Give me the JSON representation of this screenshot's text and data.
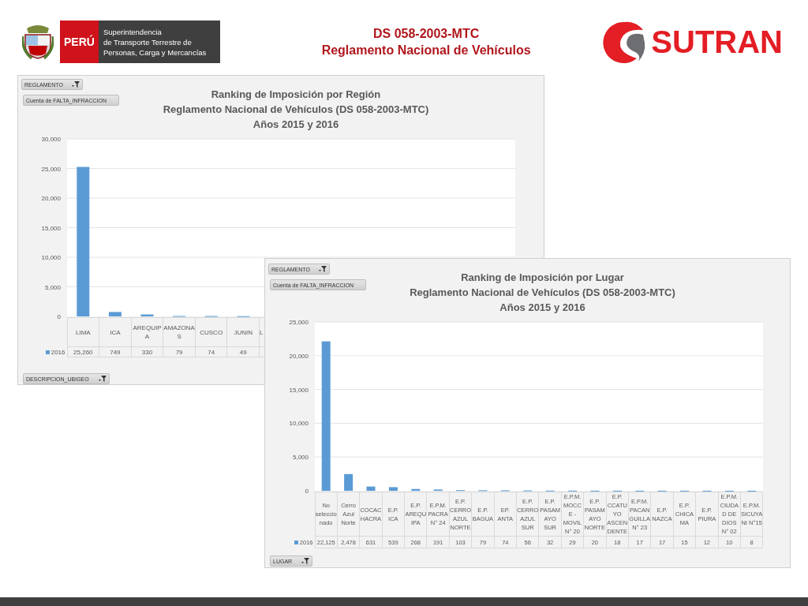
{
  "header": {
    "country": "PERÚ",
    "agency_lines": [
      "Superintendencia",
      "de Transporte Terrestre de",
      "Personas, Carga y Mercancías"
    ],
    "title_lines": [
      "DS 058-2003-MTC",
      "Reglamento Nacional de Vehículos"
    ],
    "brand": "SUTRAN"
  },
  "panels": [
    {
      "filter": "REGLAMENTO",
      "value_field": "Cuenta de FALTA_INFRACCION",
      "title_lines": [
        "Ranking de Imposición por Región",
        "Reglamento Nacional de Vehículos (DS 058-2003-MTC)",
        "Años 2015 y 2016"
      ],
      "axis_field": "DESCRIPCION_UBIGEO",
      "chart_data": {
        "type": "bar",
        "categories": [
          "LIMA",
          "ICA",
          "AREQUIPA",
          "AMAZONAS",
          "CUSCO",
          "JUNIN",
          "L"
        ],
        "series": [
          {
            "name": "2016",
            "color": "#5b9bd5",
            "values": [
              25260,
              749,
              330,
              79,
              74,
              49,
              null
            ]
          }
        ],
        "ylim": [
          0,
          30000
        ],
        "yticks": [
          {
            "value": 0,
            "label": "0"
          },
          {
            "value": 5000,
            "label": "5,000"
          },
          {
            "value": 10000,
            "label": "10,000"
          },
          {
            "value": 15000,
            "label": "15,000"
          },
          {
            "value": 20000,
            "label": "20,000"
          },
          {
            "value": 25000,
            "label": "25,000"
          },
          {
            "value": 30000,
            "label": "30,000"
          }
        ],
        "value_labels": [
          "25,260",
          "749",
          "330",
          "79",
          "74",
          "49"
        ],
        "grid": true
      }
    },
    {
      "filter": "REGLAMENTO",
      "value_field": "Cuenta de FALTA_INFRACCION",
      "title_lines": [
        "Ranking de Imposición por Lugar",
        "Reglamento Nacional de Vehículos (DS 058-2003-MTC)",
        "Años 2015 y 2016"
      ],
      "axis_field": "LUGAR",
      "chart_data": {
        "type": "bar",
        "categories": [
          "No seleccionado",
          "Cerro Azul Norte",
          "COCACHACRA",
          "E.P. ICA",
          "E.P. AREQUIPA",
          "E.P.M. PACRA N° 24",
          "E.P. CERRO AZUL NORTE",
          "E.P. BAGUA",
          "EP. ANTA",
          "E.P. CERRO AZUL SUR",
          "E.P. PASAMAYO SUR",
          "E.P.M. MOCCE - MOVIL N° 20",
          "E.P. PASAMAYO NORTE",
          "E.P. CCATUYO ASCENDENTE",
          "E.P.M. PACANGUILLA N° 23",
          "E.P. NAZCA",
          "E.P. CHICAMA",
          "E.P. PIURA",
          "E.P.M. CIUDAD DE DIOS N° 02",
          "E.P.M. SICUYANI N°15"
        ],
        "series": [
          {
            "name": "2016",
            "color": "#5b9bd5",
            "values": [
              22125,
              2478,
              631,
              539,
              268,
              191,
              103,
              79,
              74,
              56,
              32,
              29,
              20,
              18,
              17,
              17,
              15,
              12,
              10,
              8
            ]
          }
        ],
        "ylim": [
          0,
          25000
        ],
        "yticks": [
          {
            "value": 0,
            "label": "0"
          },
          {
            "value": 5000,
            "label": "5,000"
          },
          {
            "value": 10000,
            "label": "10,000"
          },
          {
            "value": 15000,
            "label": "15,000"
          },
          {
            "value": 20000,
            "label": "20,000"
          },
          {
            "value": 25000,
            "label": "25,000"
          }
        ],
        "value_labels": [
          "22,125",
          "2,478",
          "631",
          "539",
          "268",
          "191",
          "103",
          "79",
          "74",
          "56",
          "32",
          "29",
          "20",
          "18",
          "17",
          "17",
          "15",
          "12",
          "10",
          "8"
        ],
        "grid": true
      }
    }
  ]
}
